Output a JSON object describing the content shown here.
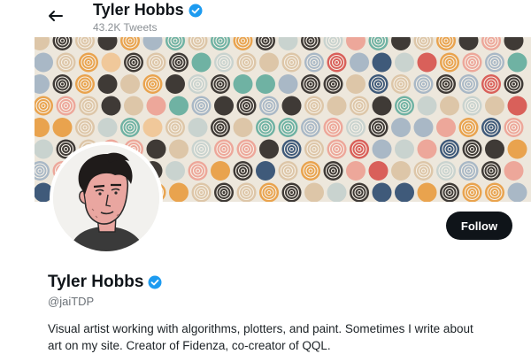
{
  "header": {
    "back_icon": "arrow-left-icon",
    "name": "Tyler Hobbs",
    "tweet_count": "43.2K Tweets",
    "verified_icon": "verified-badge-icon"
  },
  "banner": {
    "description_colors": [
      "#3f3a36",
      "#3f5a7a",
      "#d9605a",
      "#e9a34e",
      "#6fb2a3",
      "#ddc6a8",
      "#f0c89a",
      "#a9b8c6",
      "#eda79a",
      "#c9d3cf"
    ]
  },
  "profile": {
    "name": "Tyler Hobbs",
    "handle": "@jaiTDP",
    "follow_label": "Follow",
    "bio_line1": "Visual artist working with algorithms, plotters, and paint. Sometimes I write about",
    "bio_line2": "art on my site. Creator of Fidenza, co-creator of QQL."
  },
  "colors": {
    "accent": "#1d9bf0",
    "button": "#0f1419"
  }
}
